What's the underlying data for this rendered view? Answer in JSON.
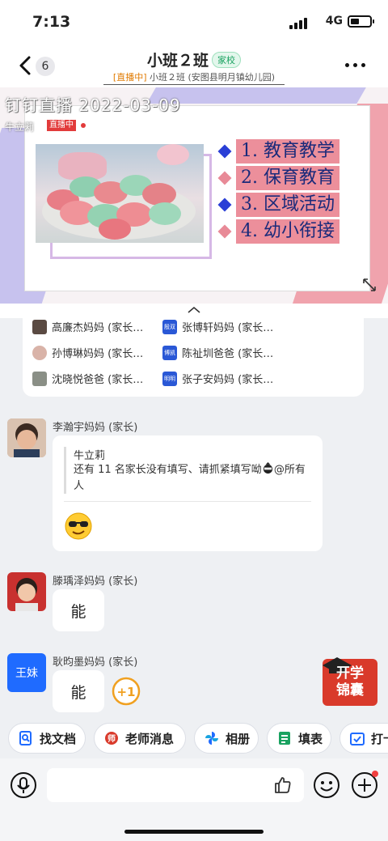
{
  "status_bar": {
    "time": "7:13",
    "network": "4G"
  },
  "nav": {
    "unread_count": "6",
    "title": "小班２班",
    "title_tag": "家校",
    "live_flag": "[直播中]",
    "live_info": " 小班２班 (安图县明月镇幼儿园)"
  },
  "live": {
    "heading": "钉钉直播 2022-03-09",
    "presenter": "牛立莉",
    "presenter_status": "直播中",
    "agenda": [
      "1. 教育教学",
      "2. 保育教育",
      "3. 区域活动",
      "4. 幼小衔接"
    ],
    "colors": {
      "diamond_blue": "#2a3fd6",
      "diamond_pink": "#e88a97",
      "agenda_bg": "#ec8f9b"
    }
  },
  "members": [
    {
      "name": "高廉杰妈妈 (家长…",
      "avatar_text": ""
    },
    {
      "name": "张博轩妈妈 (家长…",
      "avatar_text": "殷双"
    },
    {
      "name": "孙博琳妈妈 (家长…",
      "avatar_text": ""
    },
    {
      "name": "陈祉圳爸爸 (家长…",
      "avatar_text": "博凯"
    },
    {
      "name": "沈晓悦爸爸 (家长…",
      "avatar_text": ""
    },
    {
      "name": "张子安妈妈 (家长…",
      "avatar_text": "明明"
    }
  ],
  "messages": {
    "quote_msg": {
      "sender": "李瀚宇妈妈 (家长)",
      "quote_author": "牛立莉",
      "quote_text": "还有 11 名家长没有填写、请抓紧填写呦",
      "quote_mention": "@所有人"
    },
    "reply1": {
      "sender": "滕瑀泽妈妈 (家长)",
      "text": "能"
    },
    "reply2": {
      "sender": "耿昀墨妈妈 (家长)",
      "avatar_text": "王妹",
      "text": "能"
    }
  },
  "promo": {
    "line1": "开学",
    "line2": "锦囊"
  },
  "quick_actions": [
    "找文档",
    "老师消息",
    "相册",
    "填表",
    "打卡"
  ],
  "input": {
    "placeholder": ""
  },
  "colors": {
    "accent_blue": "#1f6bff",
    "brand_red": "#d93a2b",
    "tag_green": "#1aa260"
  }
}
